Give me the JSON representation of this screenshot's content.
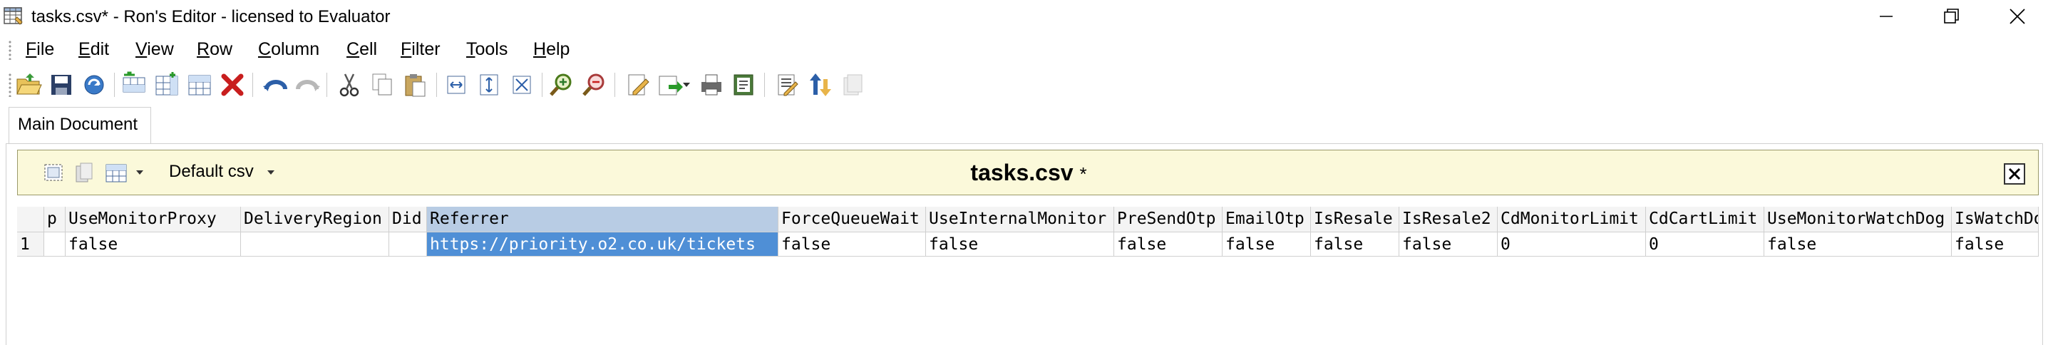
{
  "window": {
    "title": "tasks.csv* - Ron's Editor - licensed to Evaluator",
    "controls": [
      "minimize",
      "restore",
      "close"
    ]
  },
  "menu": [
    {
      "label": "File"
    },
    {
      "label": "Edit"
    },
    {
      "label": "View"
    },
    {
      "label": "Row"
    },
    {
      "label": "Column"
    },
    {
      "label": "Cell"
    },
    {
      "label": "Filter"
    },
    {
      "label": "Tools"
    },
    {
      "label": "Help"
    }
  ],
  "toolbar": {
    "icons": [
      "open-folder-icon",
      "save-icon",
      "save-all-icon",
      "insert-row-icon",
      "insert-column-icon",
      "grid-icon",
      "delete-icon",
      "undo-icon",
      "redo-icon",
      "cut-icon",
      "copy-icon",
      "paste-icon",
      "fit-width-icon",
      "fit-page-icon",
      "fit-all-icon",
      "zoom-in-icon",
      "zoom-out-icon",
      "edit-icon",
      "export-icon",
      "print-icon",
      "properties-icon",
      "document-icon",
      "sort-icon",
      "filter-icon"
    ]
  },
  "tabs": [
    {
      "label": "Main Document"
    }
  ],
  "docbar": {
    "csv_format": "Default csv",
    "filename": "tasks.csv",
    "modified_mark": "*"
  },
  "grid": {
    "columns": [
      "",
      "p",
      "UseMonitorProxy",
      "DeliveryRegion",
      "Did",
      "Referrer",
      "ForceQueueWait",
      "UseInternalMonitor",
      "PreSendOtp",
      "EmailOtp",
      "IsResale",
      "IsResale2",
      "CdMonitorLimit",
      "CdCartLimit",
      "UseMonitorWatchDog",
      "IsWatchDog"
    ],
    "rows": [
      [
        "1",
        "",
        "false",
        "",
        "",
        "https://priority.o2.co.uk/tickets",
        "false",
        "false",
        "false",
        "false",
        "false",
        "false",
        "0",
        "0",
        "false",
        "false"
      ]
    ],
    "selected_column": "Referrer"
  },
  "colors": {
    "docbar_bg": "#fbf9da",
    "selection_header": "#b8cce4",
    "selection_cell": "#4f8fd6"
  }
}
